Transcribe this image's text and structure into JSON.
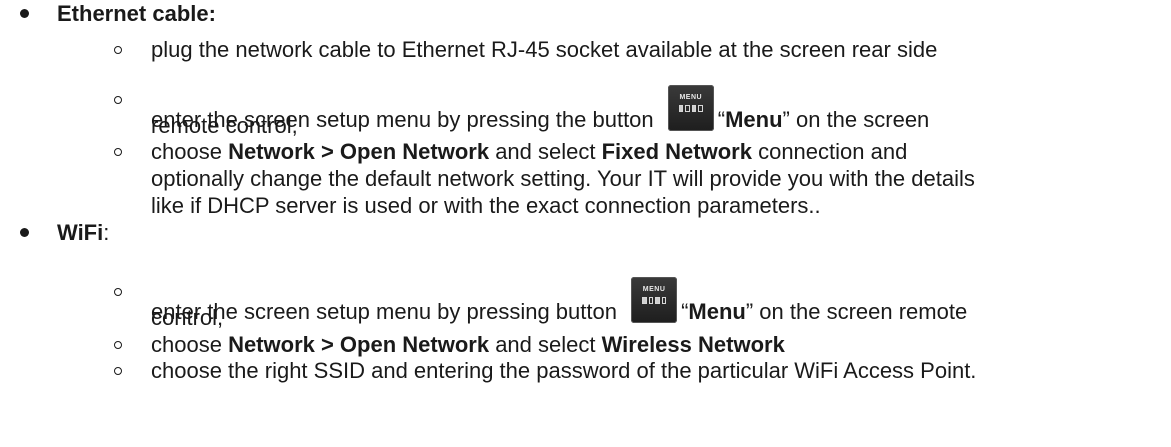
{
  "sections": [
    {
      "label": "Ethernet cable:",
      "items": [
        {
          "line1": "plug the  network cable to Ethernet RJ-45 socket available at the screen rear side"
        },
        {
          "pre": "enter the screen setup menu by pressing the button ",
          "quote_open": "“",
          "menu_label": "Menu",
          "post": "” on the screen",
          "line2": "remote control,"
        },
        {
          "pre": "choose ",
          "bold1": "Network > Open Network",
          "mid": " and select ",
          "bold2": "Fixed Network",
          "post": " connection and",
          "line2": "optionally change the default network setting.  Your IT will provide you with the details",
          "line3": "like if DHCP server is used or with the exact connection parameters.."
        }
      ]
    },
    {
      "label": "WiFi",
      "label_suffix": ":",
      "items": [
        {
          "pre": "enter the screen setup menu by pressing button ",
          "quote_open": "“",
          "menu_label": "Menu",
          "post": "” on the screen remote",
          "line2": "control,"
        },
        {
          "pre": "choose ",
          "bold1": "Network > Open Network",
          "mid": " and select ",
          "bold2": "Wireless Network"
        },
        {
          "line1": "choose the right SSID and entering the password of the particular WiFi Access Point."
        }
      ]
    }
  ],
  "menu_button": {
    "icon_text": "MENU"
  }
}
